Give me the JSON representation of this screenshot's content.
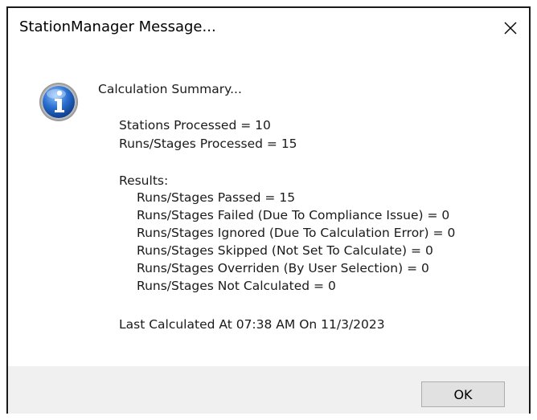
{
  "window": {
    "title": "StationManager Message...",
    "close_glyph": "✕"
  },
  "message": {
    "heading": "Calculation Summary...",
    "stations_processed": "Stations Processed = 10",
    "runs_processed": "Runs/Stages Processed = 15",
    "results_label": "Results:",
    "results": [
      "Runs/Stages Passed = 15",
      "Runs/Stages Failed (Due To Compliance Issue) = 0",
      "Runs/Stages Ignored (Due To Calculation Error) = 0",
      "Runs/Stages Skipped (Not Set To Calculate) = 0",
      "Runs/Stages Overriden (By User Selection) = 0",
      "Runs/Stages Not Calculated = 0"
    ],
    "last_calculated": "Last Calculated At 07:38 AM On 11/3/2023"
  },
  "buttons": {
    "ok_label": "OK"
  },
  "icon": {
    "name": "info-icon",
    "color": "#1d5fb8"
  }
}
